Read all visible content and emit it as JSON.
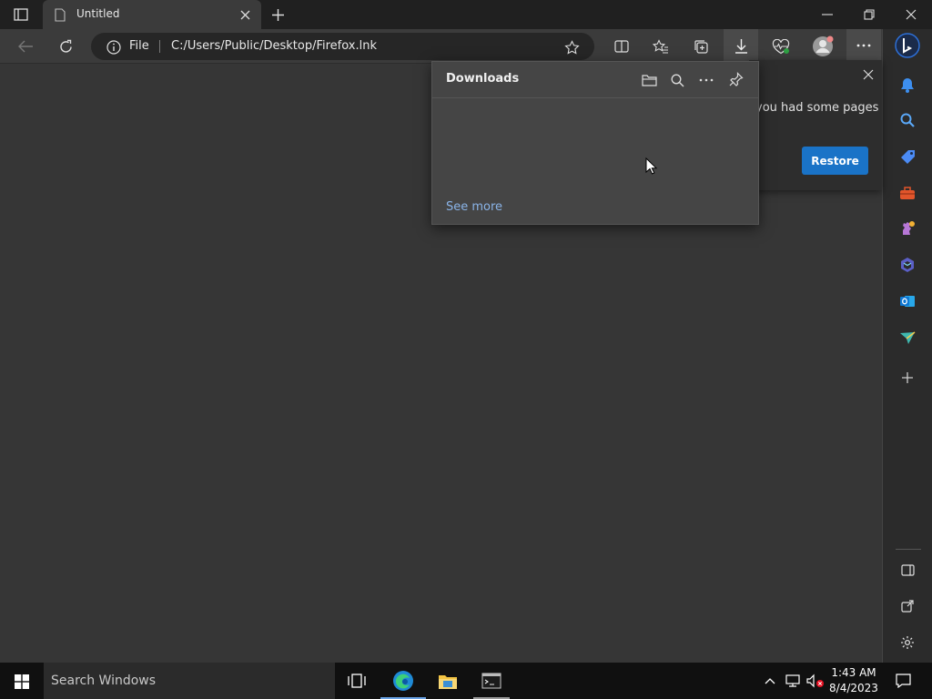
{
  "window": {
    "tab_title": "Untitled",
    "controls": {
      "minimize": "minimize-icon",
      "restore": "restore-window-icon",
      "close": "close-icon"
    }
  },
  "toolbar": {
    "address_scheme": "File",
    "address_url": "C:/Users/Public/Desktop/Firefox.lnk"
  },
  "downloads_panel": {
    "title": "Downloads",
    "see_more": "See more"
  },
  "restore_popup": {
    "message": "you had some pages",
    "restore_label": "Restore"
  },
  "taskbar": {
    "search_placeholder": "Search Windows",
    "time": "1:43 AM",
    "date": "8/4/2023"
  },
  "colors": {
    "accent": "#1a73c7",
    "link": "#8ab4e8",
    "background": "#363636"
  }
}
